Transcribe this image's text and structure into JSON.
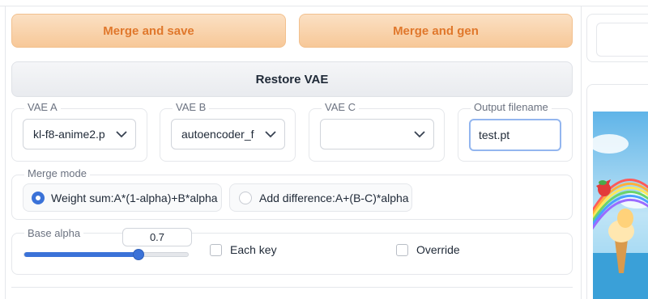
{
  "buttons": {
    "merge_save": "Merge and save",
    "merge_gen": "Merge and gen",
    "restore_vae": "Restore VAE"
  },
  "vae_a": {
    "label": "VAE A",
    "value": "kl-f8-anime2.p"
  },
  "vae_b": {
    "label": "VAE B",
    "value": "autoencoder_f"
  },
  "vae_c": {
    "label": "VAE C",
    "value": ""
  },
  "output": {
    "label": "Output filename",
    "value": "test.pt"
  },
  "merge_mode": {
    "label": "Merge mode",
    "options": [
      "Weight sum:A*(1-alpha)+B*alpha",
      "Add difference:A+(B-C)*alpha"
    ],
    "selected": "Weight sum:A*(1-alpha)+B*alpha"
  },
  "base_alpha": {
    "label": "Base alpha",
    "value": "0.7",
    "min": 0,
    "max": 1
  },
  "checkboxes": {
    "each_key": "Each key",
    "override": "Override"
  },
  "colors": {
    "accent": "#3b72d8",
    "orange_text": "#e0782c",
    "orange_bg": "#f7c898"
  }
}
